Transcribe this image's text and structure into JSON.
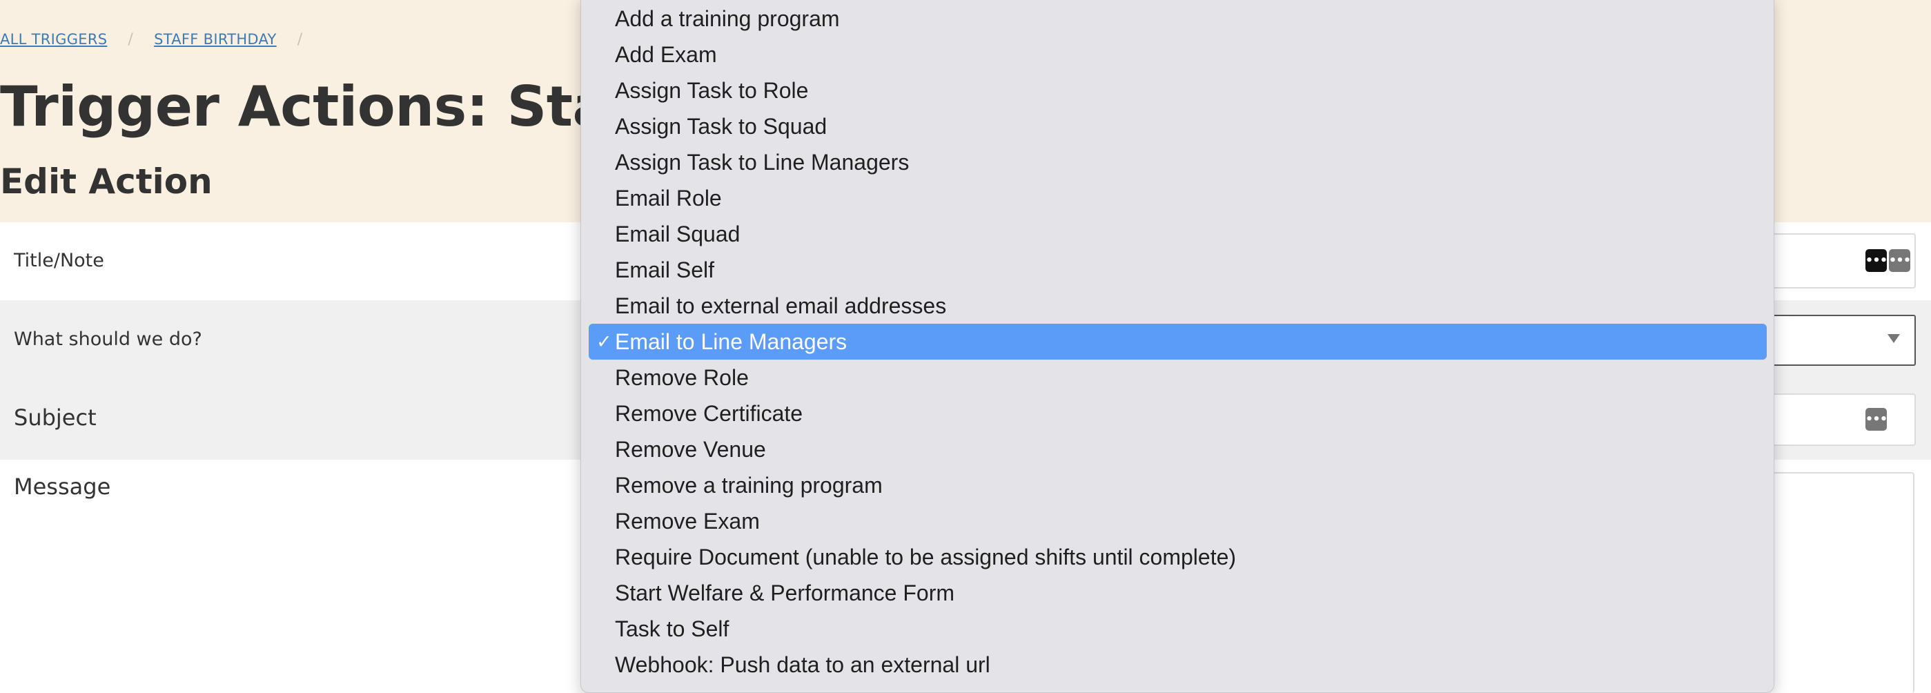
{
  "breadcrumb": {
    "items": [
      "ALL TRIGGERS",
      "STAFF BIRTHDAY"
    ],
    "separator": "/"
  },
  "page_title": "Trigger Actions: Staff Birthday",
  "section_title": "Edit Action",
  "form": {
    "title_label": "Title/Note",
    "what_label": "What should we do?",
    "subject_label": "Subject",
    "message_label": "Message"
  },
  "icons": {
    "dots": "more-dots-icon",
    "caret": "chevron-down-icon",
    "check": "checkmark-icon"
  },
  "colors": {
    "header_bg": "#faf0e2",
    "link": "#3d7bb5",
    "selected_bg": "#5b9cf8",
    "dropdown_bg": "#e4e3e8"
  },
  "dropdown": {
    "selected_index": 9,
    "check_glyph": "✓",
    "options": [
      "Add a training program",
      "Add Exam",
      "Assign Task to Role",
      "Assign Task to Squad",
      "Assign Task to Line Managers",
      "Email Role",
      "Email Squad",
      "Email Self",
      "Email to external email addresses",
      "Email to Line Managers",
      "Remove Role",
      "Remove Certificate",
      "Remove Venue",
      "Remove a training program",
      "Remove Exam",
      "Require Document (unable to be assigned shifts until complete)",
      "Start Welfare & Performance Form",
      "Task to Self",
      "Webhook: Push data to an external url"
    ]
  }
}
